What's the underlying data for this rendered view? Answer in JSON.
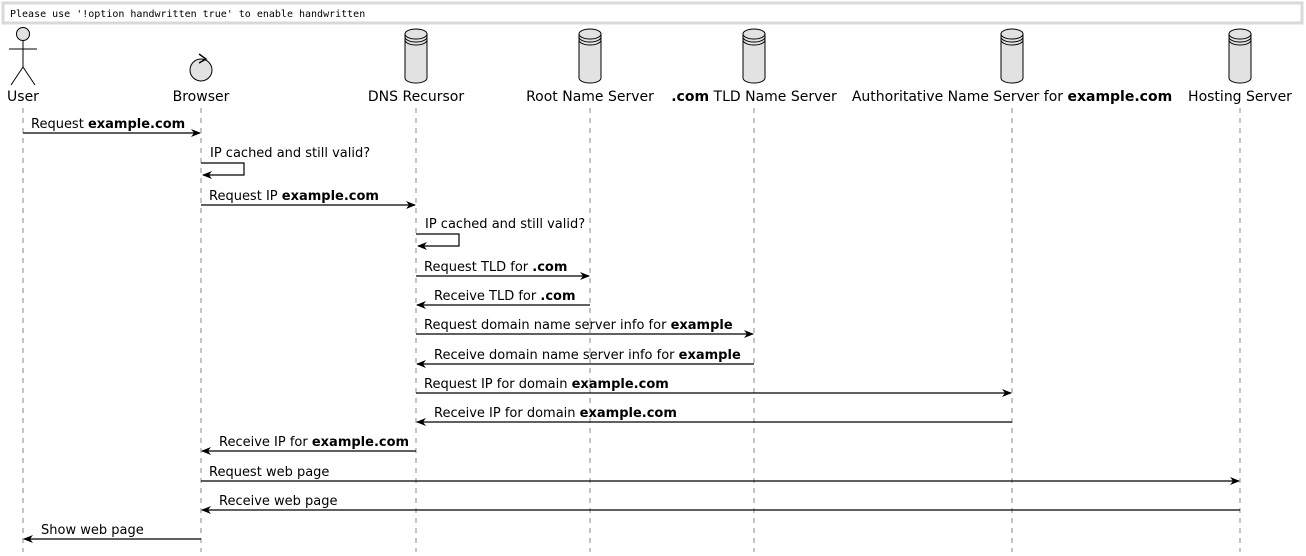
{
  "banner": {
    "text": "Please use '!option handwritten true' to enable handwritten"
  },
  "participants": [
    {
      "id": "user",
      "kind": "actor",
      "label": [
        {
          "t": "User"
        }
      ]
    },
    {
      "id": "browser",
      "kind": "control",
      "label": [
        {
          "t": "Browser"
        }
      ]
    },
    {
      "id": "dnsr",
      "kind": "database",
      "label": [
        {
          "t": "DNS Recursor"
        }
      ]
    },
    {
      "id": "root",
      "kind": "database",
      "label": [
        {
          "t": "Root Name Server"
        }
      ]
    },
    {
      "id": "tld",
      "kind": "database",
      "label": [
        {
          "t": ".com",
          "b": true
        },
        {
          "t": " TLD Name Server"
        }
      ]
    },
    {
      "id": "auth",
      "kind": "database",
      "label": [
        {
          "t": "Authoritative Name Server for "
        },
        {
          "t": "example.com",
          "b": true
        }
      ]
    },
    {
      "id": "host",
      "kind": "database",
      "label": [
        {
          "t": "Hosting Server"
        }
      ]
    }
  ],
  "messages": [
    {
      "from": "user",
      "to": "browser",
      "text": [
        {
          "t": "Request "
        },
        {
          "t": "example.com",
          "b": true
        }
      ]
    },
    {
      "from": "browser",
      "to": "browser",
      "text": [
        {
          "t": "IP cached and still valid?"
        }
      ]
    },
    {
      "from": "browser",
      "to": "dnsr",
      "text": [
        {
          "t": "Request IP "
        },
        {
          "t": "example.com",
          "b": true
        }
      ]
    },
    {
      "from": "dnsr",
      "to": "dnsr",
      "text": [
        {
          "t": "IP cached and still valid?"
        }
      ]
    },
    {
      "from": "dnsr",
      "to": "root",
      "text": [
        {
          "t": "Request TLD for "
        },
        {
          "t": ".com",
          "b": true
        }
      ]
    },
    {
      "from": "root",
      "to": "dnsr",
      "text": [
        {
          "t": "Receive TLD for "
        },
        {
          "t": ".com",
          "b": true
        }
      ]
    },
    {
      "from": "dnsr",
      "to": "tld",
      "text": [
        {
          "t": "Request domain name server info for "
        },
        {
          "t": "example",
          "b": true
        }
      ]
    },
    {
      "from": "tld",
      "to": "dnsr",
      "text": [
        {
          "t": "Receive domain name server info for "
        },
        {
          "t": "example",
          "b": true
        }
      ]
    },
    {
      "from": "dnsr",
      "to": "auth",
      "text": [
        {
          "t": "Request IP for domain "
        },
        {
          "t": "example.com",
          "b": true
        }
      ]
    },
    {
      "from": "auth",
      "to": "dnsr",
      "text": [
        {
          "t": "Receive IP for domain "
        },
        {
          "t": "example.com",
          "b": true
        }
      ]
    },
    {
      "from": "dnsr",
      "to": "browser",
      "text": [
        {
          "t": "Receive IP for "
        },
        {
          "t": "example.com",
          "b": true
        }
      ]
    },
    {
      "from": "browser",
      "to": "host",
      "text": [
        {
          "t": "Request web page"
        }
      ]
    },
    {
      "from": "host",
      "to": "browser",
      "text": [
        {
          "t": "Receive web page"
        }
      ]
    },
    {
      "from": "browser",
      "to": "user",
      "text": [
        {
          "t": "Show web page"
        }
      ]
    }
  ],
  "colors": {
    "line": "#000000",
    "lifeline": "#888888",
    "shape_fill": "#e2e2e2",
    "banner_border": "#d9d9d9"
  }
}
